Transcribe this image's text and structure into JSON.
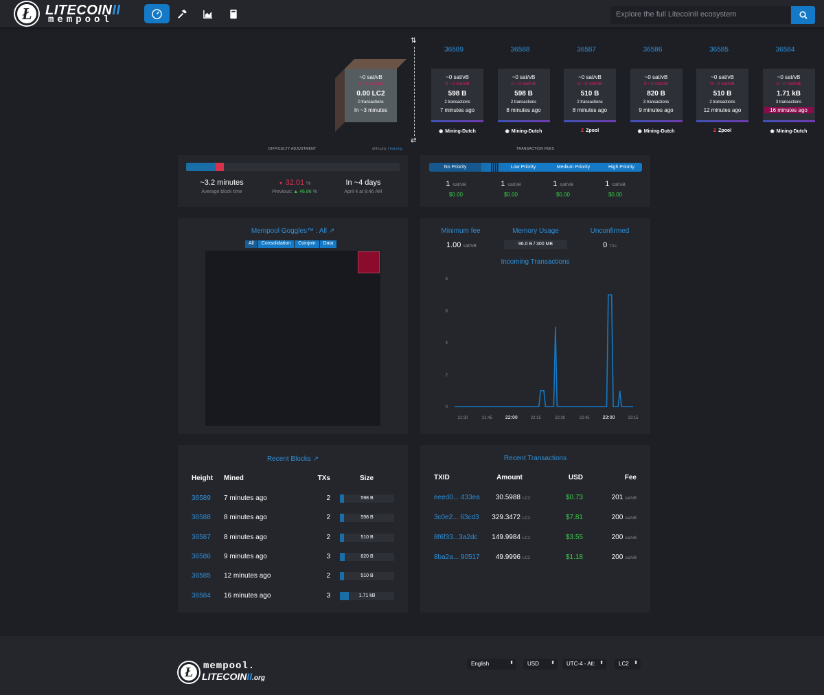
{
  "nav": {
    "logo_top": "LITECOIN",
    "logo_mark": "II",
    "logo_bottom": "mempool",
    "search_placeholder": "Explore the full LitecoinII ecosystem"
  },
  "mempool_block": {
    "fee": "~0 sat/vB",
    "range": "0 - 0 sat/vB",
    "size": "0.00 LC2",
    "txs": "0 transactions",
    "time": "In ~3 minutes"
  },
  "blocks": [
    {
      "height": "36589",
      "fee": "~0 sat/vB",
      "range": "0 - 0 sat/vB",
      "size": "598 B",
      "txs": "2 transactions",
      "time": "7 minutes ago",
      "pool": "Mining-Dutch",
      "pool_icon": "mining-dutch-icon"
    },
    {
      "height": "36588",
      "fee": "~0 sat/vB",
      "range": "0 - 0 sat/vB",
      "size": "598 B",
      "txs": "2 transactions",
      "time": "8 minutes ago",
      "pool": "Mining-Dutch",
      "pool_icon": "mining-dutch-icon"
    },
    {
      "height": "36587",
      "fee": "~0 sat/vB",
      "range": "0 - 0 sat/vB",
      "size": "510 B",
      "txs": "2 transactions",
      "time": "8 minutes ago",
      "pool": "Zpool",
      "pool_icon": "zpool-icon"
    },
    {
      "height": "36586",
      "fee": "~0 sat/vB",
      "range": "0 - 0 sat/vB",
      "size": "820 B",
      "txs": "3 transactions",
      "time": "9 minutes ago",
      "pool": "Mining-Dutch",
      "pool_icon": "mining-dutch-icon"
    },
    {
      "height": "36585",
      "fee": "~0 sat/vB",
      "range": "0 - 0 sat/vB",
      "size": "510 B",
      "txs": "2 transactions",
      "time": "12 minutes ago",
      "pool": "Zpool",
      "pool_icon": "zpool-icon"
    },
    {
      "height": "36584",
      "fee": "~0 sat/vB",
      "range": "0 - 0 sat/vB",
      "size": "1.71 kB",
      "txs": "3 transactions",
      "time": "16 minutes ago",
      "pool": "Mining-Dutch",
      "pool_icon": "mining-dutch-icon"
    }
  ],
  "difficulty": {
    "title": "DIFFICULTY ADJUSTMENT",
    "toggle_a": "difficulty",
    "toggle_sep": "|",
    "toggle_b": "halving",
    "progress": 0.15,
    "avg_block": "~3.2 minutes",
    "avg_label": "Average block time",
    "change": "32.01",
    "change_unit": "%",
    "prev_label": "Previous:",
    "prev_value": "46.86",
    "prev_unit": "%",
    "eta": "In ~4 days",
    "eta_date": "April 4 at 8:46 AM"
  },
  "fees": {
    "title": "TRANSACTION FEES",
    "labels": [
      "No Priority",
      "Low Priority",
      "Medium Priority",
      "High Priority"
    ],
    "values": [
      "1",
      "1",
      "1",
      "1"
    ],
    "unit": "sat/vB",
    "usd": [
      "$0.00",
      "$0.00",
      "$0.00",
      "$0.00"
    ]
  },
  "goggles": {
    "title": "Mempool Goggles™ : All",
    "tabs": [
      "All",
      "Consolidation",
      "Coinjoin",
      "Data"
    ]
  },
  "stats": {
    "min_fee_label": "Minimum fee",
    "min_fee": "1.00",
    "min_fee_unit": "sat/vB",
    "memory_label": "Memory Usage",
    "memory": "96.0 B / 300 MB",
    "unconfirmed_label": "Unconfirmed",
    "unconfirmed": "0",
    "unconfirmed_unit": "TXs",
    "incoming_title": "Incoming Transactions"
  },
  "chart_data": {
    "type": "line",
    "title": "Incoming Transactions",
    "x": [
      "21:30",
      "21:45",
      "22:00",
      "22:15",
      "22:30",
      "22:45",
      "23:00",
      "23:15"
    ],
    "yticks": [
      0,
      2,
      4,
      6,
      8
    ],
    "ylim": [
      0,
      8
    ],
    "series": [
      {
        "values": [
          0,
          0,
          0,
          0,
          0,
          0,
          0,
          0,
          0,
          0,
          0,
          0,
          0,
          0,
          0,
          0,
          0,
          0,
          0,
          0,
          0,
          0,
          0,
          0,
          0,
          0,
          0,
          0,
          0,
          0,
          0,
          0,
          0,
          0,
          0,
          0,
          0,
          0,
          0,
          0,
          0,
          0,
          0,
          0,
          0,
          0,
          0,
          0,
          0,
          0,
          0,
          0,
          1,
          1,
          1,
          0,
          0,
          0,
          0,
          0,
          0,
          5,
          0,
          0,
          0,
          0,
          0,
          0,
          0,
          0,
          0,
          0,
          0,
          0,
          0,
          0,
          0,
          0,
          0,
          0,
          0,
          0,
          0,
          0,
          0,
          0,
          0,
          0,
          0,
          0,
          0,
          0,
          0,
          7,
          7,
          7,
          0,
          0,
          0,
          0,
          1,
          0,
          0,
          0,
          0,
          0,
          0,
          0,
          0
        ]
      }
    ]
  },
  "recent_blocks": {
    "title": "Recent Blocks",
    "headers": [
      "Height",
      "Mined",
      "TXs",
      "Size"
    ],
    "rows": [
      {
        "height": "36589",
        "mined": "7 minutes ago",
        "txs": "2",
        "size": "598 B",
        "fill": 0.08
      },
      {
        "height": "36588",
        "mined": "8 minutes ago",
        "txs": "2",
        "size": "598 B",
        "fill": 0.08
      },
      {
        "height": "36587",
        "mined": "8 minutes ago",
        "txs": "2",
        "size": "510 B",
        "fill": 0.07
      },
      {
        "height": "36586",
        "mined": "9 minutes ago",
        "txs": "3",
        "size": "820 B",
        "fill": 0.09
      },
      {
        "height": "36585",
        "mined": "12 minutes ago",
        "txs": "2",
        "size": "510 B",
        "fill": 0.07
      },
      {
        "height": "36584",
        "mined": "16 minutes ago",
        "txs": "3",
        "size": "1.71 kB",
        "fill": 0.16
      }
    ]
  },
  "recent_tx": {
    "title": "Recent Transactions",
    "headers": [
      "TXID",
      "Amount",
      "USD",
      "Fee"
    ],
    "rows": [
      {
        "txid": "eeed0... 433ea",
        "amount": "30.5988",
        "unit": "LC2",
        "usd": "$0.73",
        "fee": "201",
        "fee_unit": "sat/vB"
      },
      {
        "txid": "3c0e2... 63cd3",
        "amount": "329.3472",
        "unit": "LC2",
        "usd": "$7.81",
        "fee": "200",
        "fee_unit": "sat/vB"
      },
      {
        "txid": "8f6f33...3a2dc",
        "amount": "149.9984",
        "unit": "LC2",
        "usd": "$3.55",
        "fee": "200",
        "fee_unit": "sat/vB"
      },
      {
        "txid": "8ba2a... 90517",
        "amount": "49.9996",
        "unit": "LC2",
        "usd": "$1.18",
        "fee": "200",
        "fee_unit": "sat/vB"
      }
    ]
  },
  "footer": {
    "logo_top": "mempool.",
    "logo_mid": "LITECOIN",
    "logo_mark": "II",
    "logo_tld": ".org",
    "selects": [
      "English",
      "USD",
      "UTC-4 - Atl:",
      "LC2"
    ]
  }
}
